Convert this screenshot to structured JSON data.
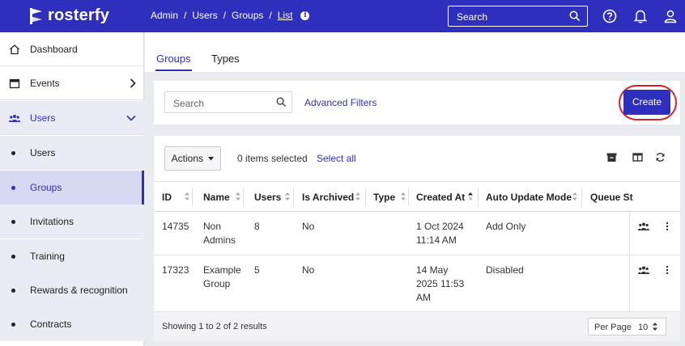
{
  "app": {
    "logo_text": "rosterfy"
  },
  "breadcrumb": [
    "Admin",
    "Users",
    "Groups",
    "List"
  ],
  "breadcrumb_separator": "/",
  "top_search": {
    "placeholder": "Search"
  },
  "sidebar": {
    "items": [
      {
        "label": "Dashboard",
        "icon": "home-icon"
      },
      {
        "label": "Events",
        "icon": "calendar-icon",
        "chevron": "chevron-right-icon"
      },
      {
        "label": "Users",
        "icon": "users-icon",
        "chevron": "chevron-down-icon"
      }
    ],
    "sub_items": [
      {
        "label": "Users"
      },
      {
        "label": "Groups",
        "active": true
      },
      {
        "label": "Invitations"
      },
      {
        "label": "Training"
      },
      {
        "label": "Rewards & recognition"
      },
      {
        "label": "Contracts"
      }
    ]
  },
  "tabs": [
    {
      "label": "Groups",
      "active": true
    },
    {
      "label": "Types",
      "active": false
    }
  ],
  "filters": {
    "search_placeholder": "Search",
    "advanced_filters": "Advanced Filters",
    "create_label": "Create"
  },
  "table": {
    "actions_label": "Actions",
    "selected_text": "0 items selected",
    "select_all": "Select all",
    "columns": [
      "ID",
      "Name",
      "Users",
      "Is Archived",
      "Type",
      "Created At",
      "Auto Update Mode",
      "Queue St"
    ],
    "rows": [
      {
        "id": "14735",
        "name_1": "Non",
        "name_2": "Admins",
        "users": "8",
        "archived": "No",
        "type": "",
        "created_1": "1 Oct 2024",
        "created_2": "11:14 AM",
        "created_3": "",
        "mode_1": "Add Only",
        "mode_2": ""
      },
      {
        "id": "17323",
        "name_1": "Example",
        "name_2": "Group",
        "users": "5",
        "archived": "No",
        "type": "",
        "created_1": "14 May",
        "created_2": "2025 11:53",
        "created_3": "AM",
        "mode_1": "Disabled",
        "mode_2": ""
      }
    ],
    "footer": {
      "showing": "Showing 1 to 2 of 2 results",
      "per_page_label": "Per Page",
      "per_page_value": "10"
    }
  },
  "colors": {
    "brand": "#2f2fbd",
    "highlight_ring": "#d92020"
  }
}
